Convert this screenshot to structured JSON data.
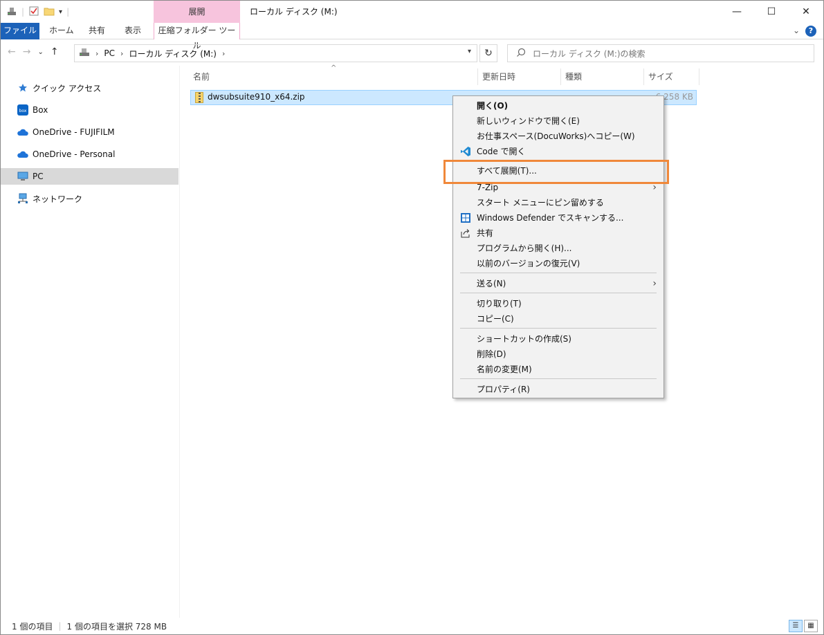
{
  "titlebar": {
    "context_tab": "展開",
    "window_title": "ローカル ディスク (M:)",
    "min_icon": "—",
    "max_icon": "☐",
    "close_icon": "✕"
  },
  "ribbon": {
    "tabs": [
      {
        "label": "ファイル"
      },
      {
        "label": "ホーム"
      },
      {
        "label": "共有"
      },
      {
        "label": "表示"
      }
    ],
    "context_tool": "圧縮フォルダー ツール",
    "help": "?"
  },
  "nav": {
    "back": "←",
    "forward": "→",
    "recent": "⌄",
    "up": "↑",
    "breadcrumb": [
      "PC",
      "ローカル ディスク (M:)"
    ],
    "refresh": "↻",
    "search_placeholder": "ローカル ディスク (M:)の検索"
  },
  "sidebar": {
    "items": [
      {
        "label": "クイック アクセス",
        "icon": "star-icon"
      },
      {
        "label": "Box",
        "icon": "box-icon"
      },
      {
        "label": "OneDrive - FUJIFILM",
        "icon": "cloud-icon"
      },
      {
        "label": "OneDrive - Personal",
        "icon": "cloud-icon"
      },
      {
        "label": "PC",
        "icon": "pc-icon"
      },
      {
        "label": "ネットワーク",
        "icon": "network-icon"
      }
    ]
  },
  "list": {
    "columns": [
      "名前",
      "更新日時",
      "種類",
      "サイズ"
    ],
    "files": [
      {
        "name": "dwsubsuite910_x64.zip",
        "size": "6,258 KB"
      }
    ]
  },
  "context_menu": {
    "items": [
      {
        "label": "開く(O)"
      },
      {
        "label": "新しいウィンドウで開く(E)"
      },
      {
        "label": "お仕事スペース(DocuWorks)へコピー(W)"
      },
      {
        "label": "Code で開く"
      },
      {
        "label": "すべて展開(T)..."
      },
      {
        "label": "7-Zip"
      },
      {
        "label": "スタート メニューにピン留めする"
      },
      {
        "label": "Windows Defender でスキャンする..."
      },
      {
        "label": "共有"
      },
      {
        "label": "プログラムから開く(H)..."
      },
      {
        "label": "以前のバージョンの復元(V)"
      },
      {
        "label": "送る(N)"
      },
      {
        "label": "切り取り(T)"
      },
      {
        "label": "コピー(C)"
      },
      {
        "label": "ショートカットの作成(S)"
      },
      {
        "label": "削除(D)"
      },
      {
        "label": "名前の変更(M)"
      },
      {
        "label": "プロパティ(R)"
      }
    ]
  },
  "statusbar": {
    "count": "1 個の項目",
    "selected": "1 個の項目を選択  728 MB"
  },
  "colors": {
    "file_tab": "#1c62b9",
    "context_tab": "#f7c4dd",
    "selection": "#cce8ff",
    "highlight_box": "#f0883a"
  }
}
